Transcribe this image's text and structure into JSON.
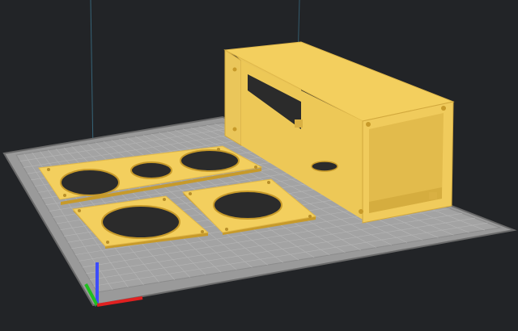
{
  "viewport": {
    "background_color": "#222427",
    "build_plate_color": "#9a9a9a",
    "build_plate_border_color": "#6a6a6a",
    "grid_line_color": "#b6b6b6",
    "model_color": "#f3cf5e",
    "model_shadow_color": "#c79a2a",
    "hole_color": "#2b2b2b"
  },
  "axes": {
    "x_color": "#e02020",
    "y_color": "#20c020",
    "z_color": "#3c4cff"
  },
  "models": [
    {
      "name": "three-hole-plate"
    },
    {
      "name": "left-fan-plate"
    },
    {
      "name": "right-fan-plate"
    },
    {
      "name": "enclosure-box"
    }
  ]
}
